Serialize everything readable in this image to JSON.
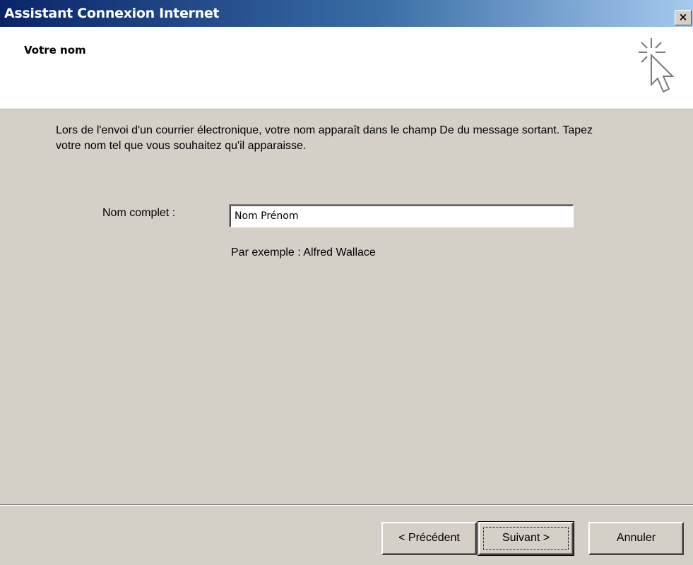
{
  "window": {
    "title": "Assistant Connexion Internet",
    "close_label": "×"
  },
  "header": {
    "heading": "Votre nom",
    "icon": "wizard-cursor-icon"
  },
  "main": {
    "description": "Lors de l'envoi d'un courrier électronique, votre nom apparaît dans le champ De du message sortant. Tapez votre nom tel que vous souhaitez qu'il apparaisse.",
    "full_name_label": "Nom complet :",
    "full_name_value": "Nom Prénom",
    "example_text": "Par exemple : Alfred Wallace"
  },
  "footer": {
    "previous_label": "< Précédent",
    "next_label": "Suivant >",
    "cancel_label": "Annuler"
  },
  "colors": {
    "titlebar_start": "#0a246a",
    "titlebar_end": "#a6caf0",
    "dialog_bg": "#d4d0c8",
    "header_bg": "#ffffff"
  }
}
